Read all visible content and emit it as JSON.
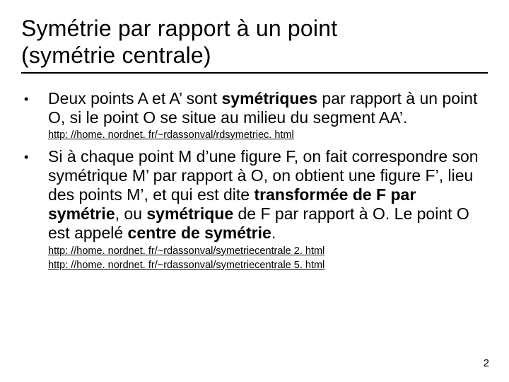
{
  "title_line1": "Symétrie par rapport à un point",
  "title_line2": "(symétrie centrale)",
  "bullets": [
    {
      "pre1": "Deux points A et A’ sont ",
      "bold1": "symétriques",
      "post1": " par rapport à un point O, si le point O se situe au milieu du segment AA’.",
      "links": [
        "http: //home. nordnet. fr/~rdassonval/rdsymetriec. html"
      ]
    },
    {
      "pre1": "Si à chaque point M d’une figure F, on fait correspondre son symétrique M’ par rapport à O, on obtient une figure F’, lieu des points M’, et qui est dite ",
      "bold1": "transformée de F par symétrie",
      "mid1": ", ou ",
      "bold2": "symétrique",
      "mid2": " de F par rapport à O. Le point O est appelé ",
      "bold3": "centre de symétrie",
      "post1": ".",
      "links": [
        "http: //home. nordnet. fr/~rdassonval/symetriecentrale 2. html",
        "http: //home. nordnet. fr/~rdassonval/symetriecentrale 5. html"
      ]
    }
  ],
  "page_number": "2"
}
